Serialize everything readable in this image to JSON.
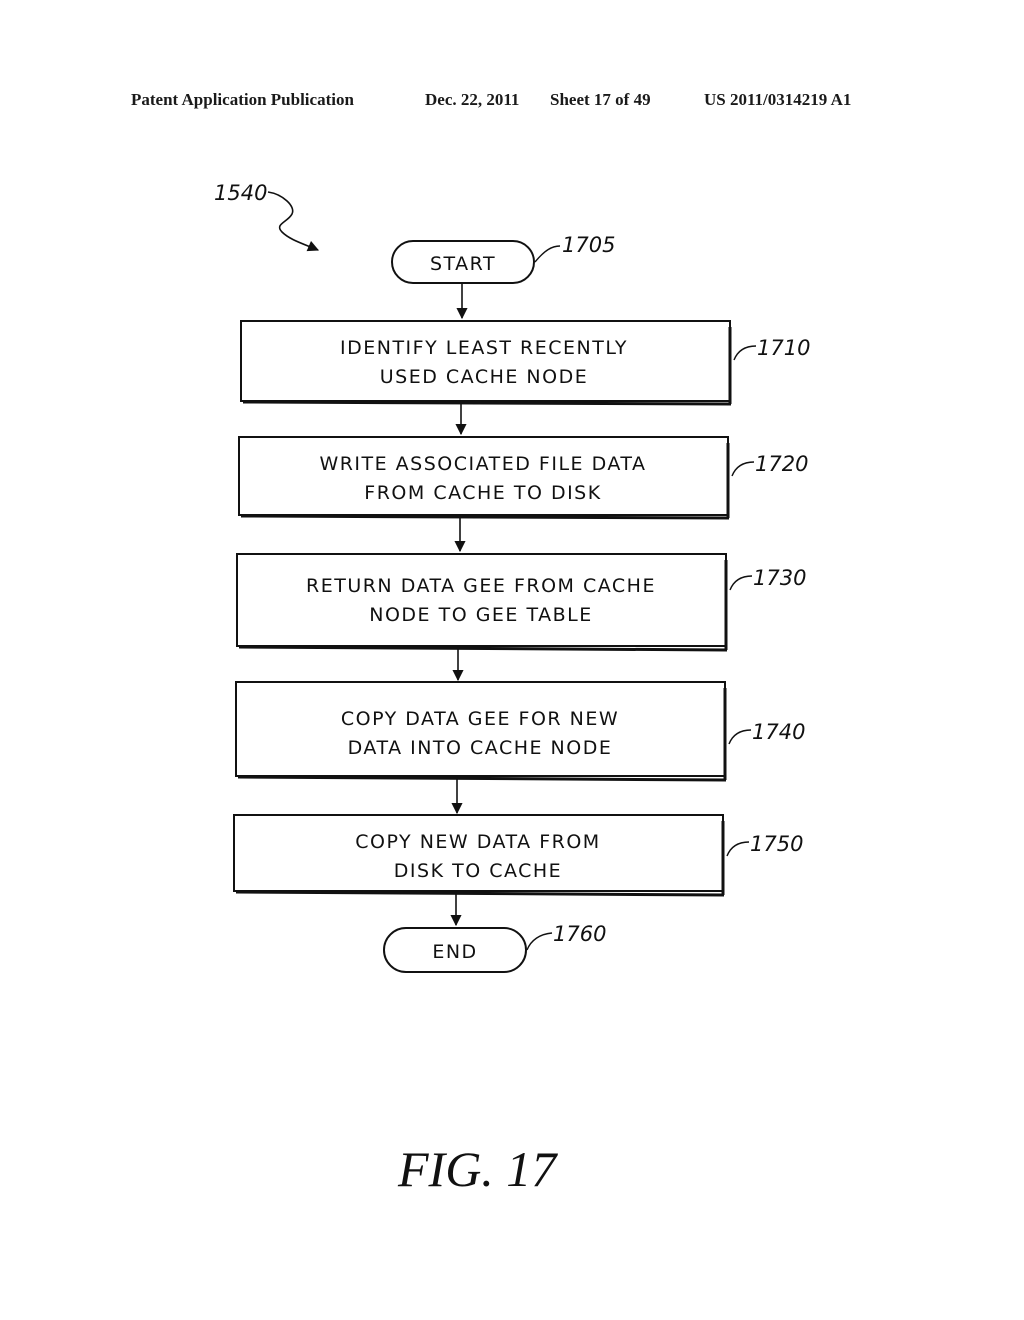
{
  "header": {
    "publication": "Patent Application Publication",
    "date": "Dec. 22, 2011",
    "sheet": "Sheet 17 of 49",
    "number": "US 2011/0314219 A1"
  },
  "diagram": {
    "process_ref": "1540",
    "start": {
      "label": "START",
      "ref": "1705"
    },
    "steps": [
      {
        "ref": "1710",
        "lines": [
          "IDENTIFY LEAST RECENTLY",
          "USED CACHE NODE"
        ]
      },
      {
        "ref": "1720",
        "lines": [
          "WRITE ASSOCIATED FILE DATA",
          "FROM CACHE TO DISK"
        ]
      },
      {
        "ref": "1730",
        "lines": [
          "RETURN DATA GEE FROM CACHE",
          "NODE TO GEE TABLE"
        ]
      },
      {
        "ref": "1740",
        "lines": [
          "COPY DATA GEE FOR NEW",
          "DATA INTO CACHE NODE"
        ]
      },
      {
        "ref": "1750",
        "lines": [
          "COPY NEW DATA FROM",
          "DISK TO CACHE"
        ]
      }
    ],
    "end": {
      "label": "END",
      "ref": "1760"
    }
  },
  "figure_label": "FIG. 17"
}
